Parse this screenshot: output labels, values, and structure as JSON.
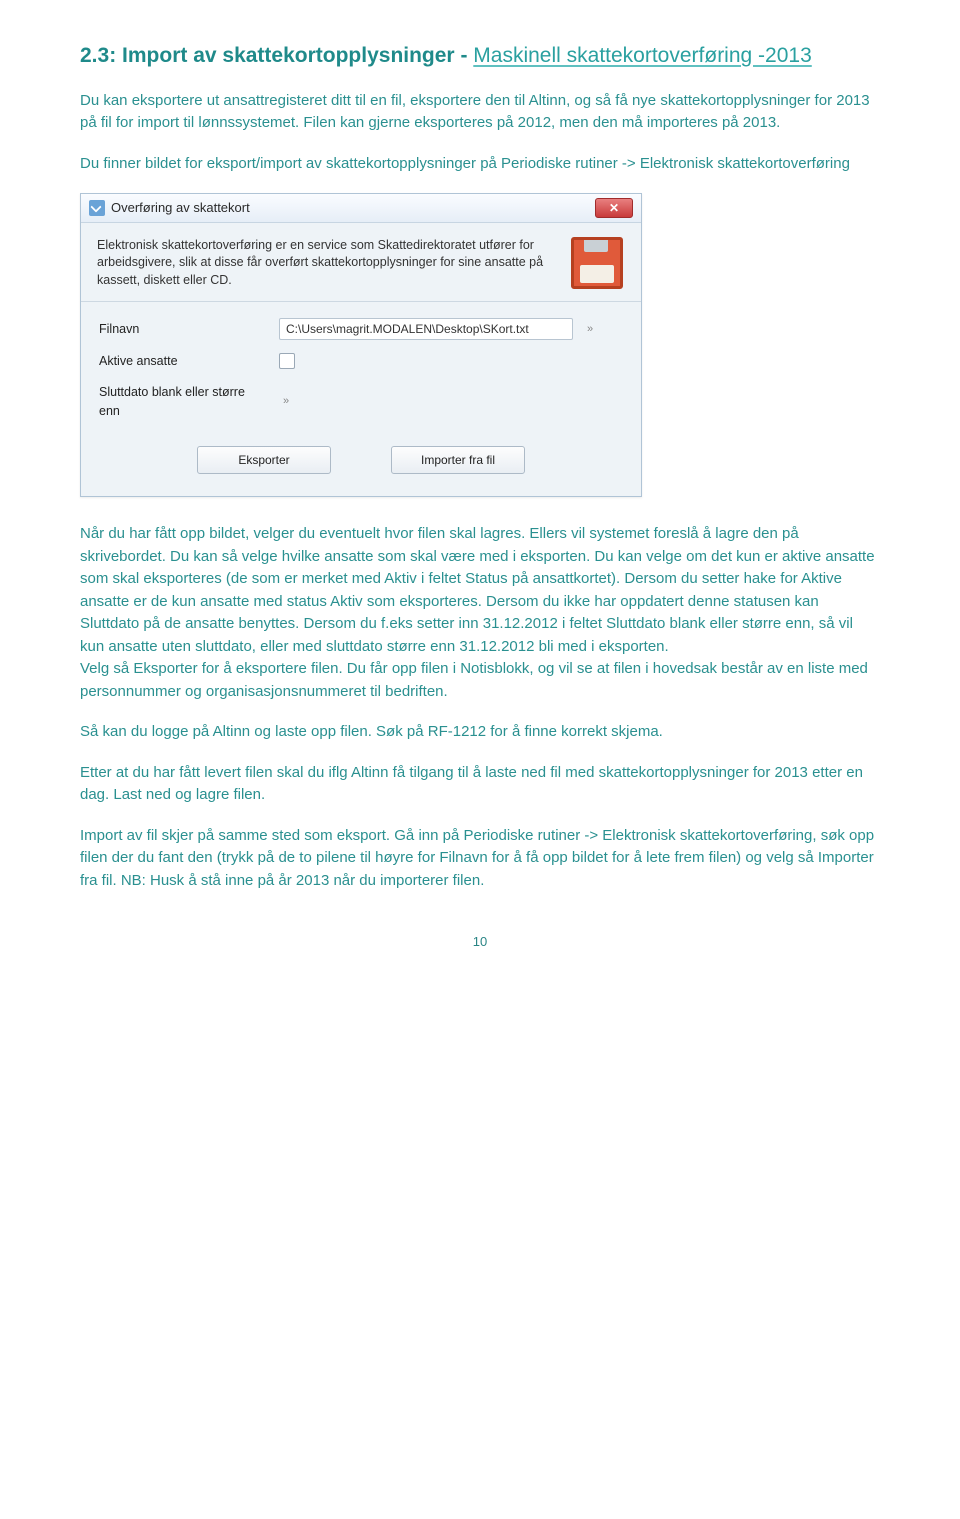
{
  "section": {
    "number": "2.3:",
    "title_main": "Import av skattekortopplysninger -",
    "title_sub": "Maskinell skattekortoverføring -2013"
  },
  "paragraphs": {
    "p1": "Du kan eksportere ut ansattregisteret ditt til en fil, eksportere den til Altinn, og så få nye skattekortopplysninger for 2013 på fil for import til lønnssystemet. Filen kan gjerne eksporteres på 2012, men den må importeres på 2013.",
    "p2": "Du finner bildet for eksport/import av skattekortopplysninger på Periodiske rutiner -> Elektronisk skattekortoverføring",
    "p3": "Når du har fått opp bildet, velger du eventuelt hvor filen skal lagres. Ellers vil systemet foreslå å lagre den på skrivebordet. Du kan så velge hvilke ansatte som skal være med i eksporten. Du kan velge om det kun er aktive ansatte som skal eksporteres (de som er merket med Aktiv i feltet Status på ansattkortet). Dersom du setter hake for Aktive ansatte er de kun ansatte med status Aktiv som eksporteres. Dersom du ikke har oppdatert denne statusen kan Sluttdato på de ansatte benyttes. Dersom du f.eks setter inn 31.12.2012 i feltet Sluttdato blank eller større enn, så vil kun ansatte uten sluttdato, eller med sluttdato større enn 31.12.2012 bli med i eksporten.",
    "p3b": "Velg så Eksporter for å eksportere filen. Du får opp filen i Notisblokk, og vil se at filen i hovedsak består av en liste med personnummer og organisasjonsnummeret til bedriften.",
    "p4": "Så kan du logge på Altinn og laste opp filen. Søk på RF-1212 for å finne korrekt skjema.",
    "p5": "Etter at du har fått levert filen skal du iflg Altinn få tilgang til å laste ned fil med skattekortopplysninger for 2013 etter en dag. Last ned og lagre filen.",
    "p6": "Import av fil skjer på samme sted som eksport. Gå inn på Periodiske rutiner -> Elektronisk skattekortoverføring, søk opp filen der du fant den (trykk på de to pilene til høyre for Filnavn for å få opp bildet for å lete frem filen) og velg så Importer fra fil. NB: Husk å stå inne på år 2013 når du importerer filen."
  },
  "dialog": {
    "title": "Overføring av skattekort",
    "description": "Elektronisk skattekortoverføring er en service som Skattedirektoratet utfører for arbeidsgivere, slik at disse får overført skattekortopplysninger for sine ansatte på kassett, diskett eller CD.",
    "labels": {
      "filnavn": "Filnavn",
      "aktive": "Aktive ansatte",
      "sluttdato": "Sluttdato blank eller større enn"
    },
    "filnavn_value": "C:\\Users\\magrit.MODALEN\\Desktop\\SKort.txt",
    "buttons": {
      "eksporter": "Eksporter",
      "importer": "Importer fra fil"
    }
  },
  "page_number": "10"
}
